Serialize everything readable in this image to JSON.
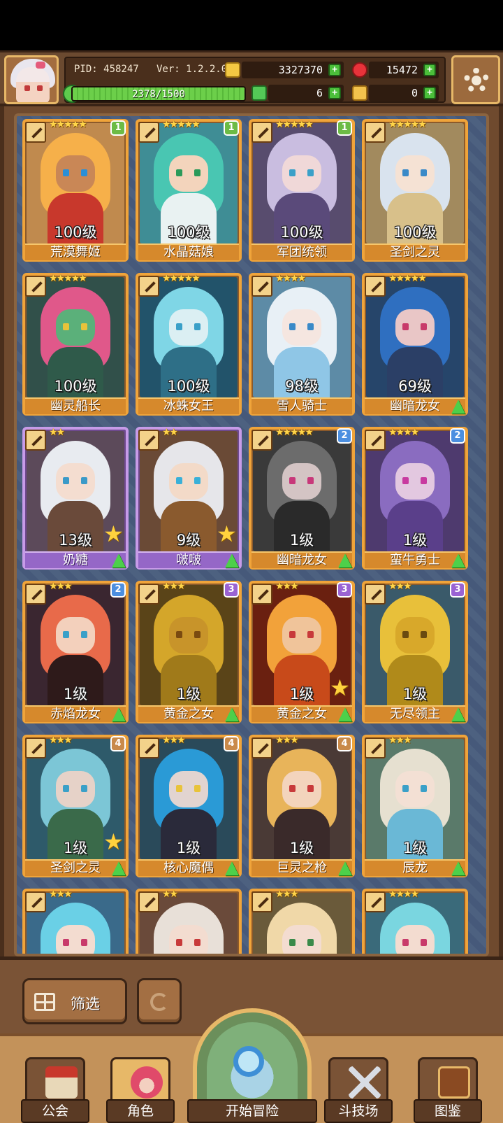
{
  "hud": {
    "pid": "PID: 458247",
    "version": "Ver: 1.2.2.0",
    "gold": "3327370",
    "gems": "15472",
    "exp_text": "2378/1500",
    "exp_fraction": 1.0,
    "clover": "6",
    "keys": "0"
  },
  "colors": {
    "frame": "#6f4a2e",
    "grid_bg": "#4a5d77",
    "card_border_gold": "#f0a43a",
    "card_border_purple": "#c79be8",
    "upgrade_green": "#4dd04a",
    "star_gold": "#ffd54a"
  },
  "cards": [
    {
      "name": "荒漠舞姬",
      "level": "100级",
      "stars": "★★★★★",
      "badge": "1",
      "badge_class": "g1",
      "fav": false,
      "up": false,
      "frame": "gold",
      "hair": "#f6b04a",
      "skin": "#c98756",
      "body": "#c8382c",
      "eye": "#2a8fd6",
      "bg": "#c08a4e"
    },
    {
      "name": "水晶菇娘",
      "level": "100级",
      "stars": "★★★★★",
      "badge": "1",
      "badge_class": "g1",
      "fav": false,
      "up": false,
      "frame": "gold",
      "hair": "#49c6b2",
      "skin": "#f3d4bc",
      "body": "#e9f2f2",
      "eye": "#2a9a5a",
      "bg": "#3f8d95"
    },
    {
      "name": "军团统领",
      "level": "100级",
      "stars": "★★★★★",
      "badge": "1",
      "badge_class": "g1",
      "fav": false,
      "up": false,
      "frame": "gold",
      "hair": "#c9bde0",
      "skin": "#f0d8d8",
      "body": "#5a4a7a",
      "eye": "#3aa0c8",
      "bg": "#584c6e"
    },
    {
      "name": "圣剑之灵",
      "level": "100级",
      "stars": "★★★★★",
      "badge": "",
      "badge_class": "",
      "fav": false,
      "up": false,
      "frame": "gold",
      "hair": "#d9e3ee",
      "skin": "#f5e2d4",
      "body": "#d8c08a",
      "eye": "#3a8ac8",
      "bg": "#a28a5e"
    },
    {
      "name": "幽灵船长",
      "level": "100级",
      "stars": "★★★★★",
      "badge": "",
      "badge_class": "",
      "fav": false,
      "up": false,
      "frame": "gold",
      "hair": "#e0588a",
      "skin": "#5bb07a",
      "body": "#2f5a4a",
      "eye": "#e8c33a",
      "bg": "#31504a"
    },
    {
      "name": "冰蛛女王",
      "level": "100级",
      "stars": "★★★★★",
      "badge": "",
      "badge_class": "",
      "fav": false,
      "up": false,
      "frame": "gold",
      "hair": "#7fd6e6",
      "skin": "#dbeff3",
      "body": "#2e6f87",
      "eye": "#3aa0c8",
      "bg": "#22536a"
    },
    {
      "name": "雪人骑士",
      "level": "98级",
      "stars": "★★★★",
      "badge": "",
      "badge_class": "",
      "fav": false,
      "up": false,
      "frame": "gold",
      "hair": "#e8f0f6",
      "skin": "#f5e6e0",
      "body": "#8fc6e6",
      "eye": "#3a8ac8",
      "bg": "#5d8ba6"
    },
    {
      "name": "幽暗龙女",
      "level": "69级",
      "stars": "★★★★★",
      "badge": "",
      "badge_class": "",
      "fav": false,
      "up": true,
      "frame": "gold",
      "hair": "#2f6fc0",
      "skin": "#e9c6c6",
      "body": "#2b3f66",
      "eye": "#c83a6a",
      "bg": "#26456a"
    },
    {
      "name": "奶糖",
      "level": "13级",
      "stars": "★★",
      "badge": "",
      "badge_class": "",
      "fav": true,
      "up": true,
      "frame": "purple",
      "hair": "#e8ebf0",
      "skin": "#f4ddd0",
      "body": "#6a4a3a",
      "eye": "#3a9ac8",
      "bg": "#5c4a5a"
    },
    {
      "name": "啵啵",
      "level": "9级",
      "stars": "★★",
      "badge": "",
      "badge_class": "",
      "fav": true,
      "up": true,
      "frame": "purple",
      "hair": "#e6e6ea",
      "skin": "#f3dac8",
      "body": "#8a5a2e",
      "eye": "#3ab0d8",
      "bg": "#6a4a36"
    },
    {
      "name": "幽暗龙女",
      "level": "1级",
      "stars": "★★★★★",
      "badge": "2",
      "badge_class": "g2",
      "fav": false,
      "up": true,
      "frame": "gold",
      "hair": "#6c6c6c",
      "skin": "#d4c4c4",
      "body": "#2a2a2a",
      "eye": "#c8387a",
      "bg": "#3a3a3a"
    },
    {
      "name": "蛮牛勇士",
      "level": "1级",
      "stars": "★★★★",
      "badge": "2",
      "badge_class": "g2",
      "fav": false,
      "up": true,
      "frame": "gold",
      "hair": "#8a6cc0",
      "skin": "#e3c8e0",
      "body": "#5a3f8a",
      "eye": "#c83aa0",
      "bg": "#4e3a6e"
    },
    {
      "name": "赤焰龙女",
      "level": "1级",
      "stars": "★★★",
      "badge": "2",
      "badge_class": "g2",
      "fav": false,
      "up": true,
      "frame": "gold",
      "hair": "#e86a4a",
      "skin": "#f3d0bc",
      "body": "#2e1a1a",
      "eye": "#3aa0c8",
      "bg": "#3a2630"
    },
    {
      "name": "黄金之女",
      "level": "1级",
      "stars": "★★★",
      "badge": "3",
      "badge_class": "g3",
      "fav": false,
      "up": true,
      "frame": "gold",
      "hair": "#d4a62a",
      "skin": "#c8942a",
      "body": "#a07a1a",
      "eye": "#7a4a10",
      "bg": "#5a4418"
    },
    {
      "name": "黄金之女",
      "level": "1级",
      "stars": "★★★",
      "badge": "3",
      "badge_class": "g3",
      "fav": true,
      "up": true,
      "frame": "gold",
      "hair": "#f2a23a",
      "skin": "#f0c49a",
      "body": "#c84a1a",
      "eye": "#c83a3a",
      "bg": "#6a2010"
    },
    {
      "name": "无尽领主",
      "level": "1级",
      "stars": "★★★",
      "badge": "3",
      "badge_class": "g3",
      "fav": false,
      "up": true,
      "frame": "gold",
      "hair": "#e8c03a",
      "skin": "#d8a82a",
      "body": "#b08a1a",
      "eye": "#6a4a10",
      "bg": "#3a5a6a"
    },
    {
      "name": "圣剑之灵",
      "level": "1级",
      "stars": "★★★",
      "badge": "4",
      "badge_class": "g4",
      "fav": true,
      "up": true,
      "frame": "gold",
      "hair": "#7cc6d6",
      "skin": "#e6d2c8",
      "body": "#3a6a4a",
      "eye": "#3aa0c8",
      "bg": "#2e5a6a"
    },
    {
      "name": "核心魔偶",
      "level": "1级",
      "stars": "★★★",
      "badge": "4",
      "badge_class": "g4",
      "fav": false,
      "up": true,
      "frame": "gold",
      "hair": "#2a9ad6",
      "skin": "#e2d4d0",
      "body": "#2a2a3a",
      "eye": "#e8c33a",
      "bg": "#2a4a5a"
    },
    {
      "name": "巨灵之枪",
      "level": "1级",
      "stars": "★★★",
      "badge": "4",
      "badge_class": "g4",
      "fav": false,
      "up": true,
      "frame": "gold",
      "hair": "#e8b45a",
      "skin": "#f3d4bc",
      "body": "#3a2a2a",
      "eye": "#c83a3a",
      "bg": "#4a3a36"
    },
    {
      "name": "辰龙",
      "level": "1级",
      "stars": "★★★",
      "badge": "",
      "badge_class": "",
      "fav": false,
      "up": true,
      "frame": "gold",
      "hair": "#e6e0d0",
      "skin": "#f3e0d4",
      "body": "#6ab8d6",
      "eye": "#3aa0c8",
      "bg": "#5a7a6a"
    },
    {
      "name": "",
      "level": "",
      "stars": "★★★",
      "badge": "",
      "badge_class": "",
      "fav": false,
      "up": false,
      "frame": "gold",
      "hair": "#6ad0e6",
      "skin": "#f3dcd0",
      "body": "#3a6a8a",
      "eye": "#c83a6a",
      "bg": "#3a6a8a"
    },
    {
      "name": "",
      "level": "",
      "stars": "★★",
      "badge": "",
      "badge_class": "",
      "fav": false,
      "up": false,
      "frame": "gold",
      "hair": "#e8e0d8",
      "skin": "#f3dcd0",
      "body": "#6a3a3a",
      "eye": "#c83a3a",
      "bg": "#6a4a3a"
    },
    {
      "name": "",
      "level": "",
      "stars": "★★★",
      "badge": "",
      "badge_class": "",
      "fav": false,
      "up": false,
      "frame": "gold",
      "hair": "#f0d8a8",
      "skin": "#f3dcd0",
      "body": "#8a6a4a",
      "eye": "#3a8a4a",
      "bg": "#6a5a3a"
    },
    {
      "name": "",
      "level": "",
      "stars": "★★★★",
      "badge": "",
      "badge_class": "",
      "fav": false,
      "up": false,
      "frame": "gold",
      "hair": "#7ad6e0",
      "skin": "#f3dcd0",
      "body": "#3a7a8a",
      "eye": "#c83a6a",
      "bg": "#3a6a7a"
    }
  ],
  "toolbar": {
    "filter_label": "筛选"
  },
  "nav": {
    "guild": "公会",
    "character": "角色",
    "adventure": "开始冒险",
    "arena": "斗技场",
    "codex": "图鉴"
  }
}
